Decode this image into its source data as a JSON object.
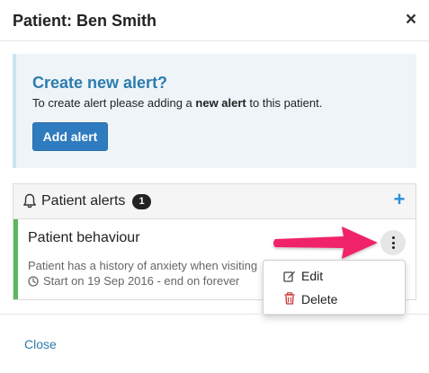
{
  "modal": {
    "title": "Patient: Ben Smith",
    "close_glyph": "×"
  },
  "create_alert": {
    "title": "Create new alert?",
    "text_before": "To create alert please adding a ",
    "text_bold": "new alert",
    "text_after": " to this patient.",
    "button_label": "Add alert"
  },
  "alerts_panel": {
    "title": "Patient alerts",
    "count": "1",
    "add_glyph": "+",
    "items": [
      {
        "title": "Patient behaviour",
        "description": "Patient has a history of anxiety when visiting",
        "dates": "Start on 19 Sep 2016 - end on forever",
        "status_color": "#5cb85c"
      }
    ]
  },
  "dropdown": {
    "items": [
      {
        "label": "Edit",
        "icon": "edit-icon"
      },
      {
        "label": "Delete",
        "icon": "trash-icon"
      }
    ]
  },
  "footer": {
    "close_label": "Close"
  },
  "colors": {
    "accent": "#2f7bbf",
    "link": "#2c7cae",
    "annotation_arrow": "#f0216a",
    "delete_icon": "#c9302c"
  },
  "icons": [
    "bell-icon",
    "plus-icon",
    "clock-icon",
    "kebab-menu-icon",
    "edit-icon",
    "trash-icon",
    "close-icon"
  ]
}
